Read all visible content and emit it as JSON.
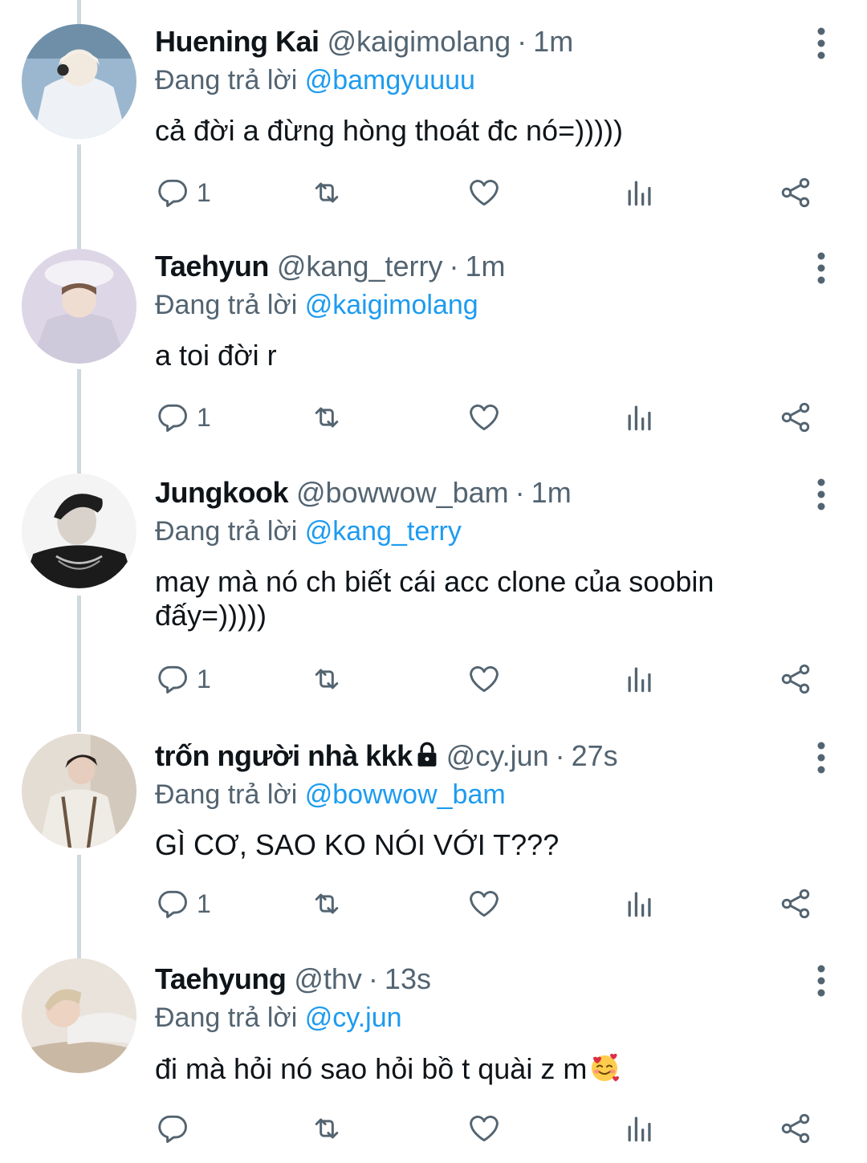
{
  "reply_prefix": "Đang trả lời",
  "colors": {
    "link": "#1d9bf0",
    "muted": "#536471",
    "text": "#0f1419",
    "thread_line": "#cfd9de"
  },
  "icons": {
    "reply": "speech-bubble-icon",
    "retweet": "retweet-icon",
    "like": "heart-icon",
    "analytics": "bar-chart-icon",
    "share": "share-icon",
    "more": "vertical-dots-icon",
    "lock": "padlock-icon"
  },
  "tweets": [
    {
      "name": "Huening Kai",
      "handle": "@kaigimolang",
      "sep": "·",
      "time": "1m",
      "reply_mention": "@bamgyuuuu",
      "text": "cả đời a đừng hòng thoát đc nó=)))))",
      "reply_count": "1"
    },
    {
      "name": "Taehyun",
      "handle": "@kang_terry",
      "sep": "·",
      "time": "1m",
      "reply_mention": "@kaigimolang",
      "text": "a toi đời r",
      "reply_count": "1"
    },
    {
      "name": "Jungkook",
      "handle": "@bowwow_bam",
      "sep": "·",
      "time": "1m",
      "reply_mention": "@kang_terry",
      "text": "may mà nó ch biết cái acc clone của soobin đấy=)))))",
      "reply_count": "1"
    },
    {
      "name": "trốn người nhà kkk",
      "locked": true,
      "handle": "@cy.jun",
      "sep": "·",
      "time": "27s",
      "reply_mention": "@bowwow_bam",
      "text": "GÌ CƠ, SAO KO NÓI VỚI T???",
      "reply_count": "1"
    },
    {
      "name": "Taehyung",
      "handle": "@thv",
      "sep": "·",
      "time": "13s",
      "reply_mention": "@cy.jun",
      "text": "đi mà hỏi nó sao hỏi bồ t quài z m",
      "emoji": "smiling-face-with-hearts-emoji",
      "reply_count": ""
    }
  ]
}
